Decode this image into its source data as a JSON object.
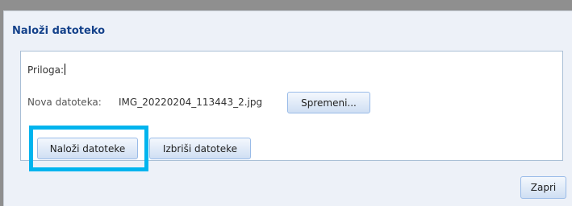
{
  "dialog": {
    "title": "Naloži datoteko",
    "attachment_label": "Priloga:",
    "new_file_label": "Nova datoteka:",
    "file_name": "IMG_20220204_113443_2.jpg",
    "change_button": "Spremeni...",
    "upload_button": "Naloži datoteke",
    "delete_button": "Izbriši datoteke",
    "close_button": "Zapri"
  },
  "colors": {
    "title": "#15428b",
    "highlight": "#00b4ee",
    "button_border": "#99bbe8"
  }
}
